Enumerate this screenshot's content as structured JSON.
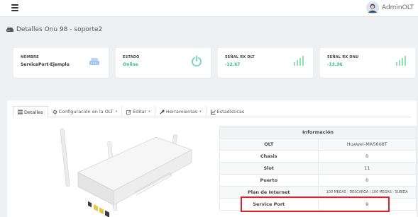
{
  "topbar": {
    "user_name": "AdminOLT"
  },
  "page": {
    "title": "Detalles Onu 98 - soporte2"
  },
  "cards": [
    {
      "label": "NOMBRE",
      "value": "ServicePort-Ejemplo",
      "value_color": "#333333",
      "icon": "router-icon",
      "icon_color": "#9ec5f0"
    },
    {
      "label": "ESTADO",
      "value": "Online",
      "value_color": "#2ebf8e",
      "icon": "power-icon",
      "icon_color": "#7fd8bc"
    },
    {
      "label": "SEÑAL RX OLT",
      "value": "-12.67",
      "value_color": "#2ebf8e",
      "icon": "signal-bars-icon",
      "icon_color": "#8fe0b8"
    },
    {
      "label": "SEÑAL RX ONU",
      "value": "-13.36",
      "value_color": "#2ebf8e",
      "icon": "signal-bars-icon",
      "icon_color": "#8fe0b8"
    }
  ],
  "tabs": [
    {
      "label": "Detalles",
      "active": true
    },
    {
      "label": "Configuración en la OLT",
      "dropdown": true
    },
    {
      "label": "Editar",
      "dropdown": true
    },
    {
      "label": "Herramientas",
      "dropdown": true
    },
    {
      "label": "Estadísticas",
      "dropdown": false
    }
  ],
  "info": {
    "header": "Información",
    "rows": [
      {
        "key": "OLT",
        "value": "Huawei-MA5608T"
      },
      {
        "key": "Chasis",
        "value": "0"
      },
      {
        "key": "Slot",
        "value": "11"
      },
      {
        "key": "Puerto",
        "value": "0"
      },
      {
        "key": "Plan de Internet",
        "value": "100 MEGAS - DESCARGA / 100 MEGAS - SUBIDA"
      },
      {
        "key": "Service Port",
        "value": "9"
      }
    ]
  },
  "colors": {
    "highlight": "#d9252a",
    "accent_green": "#2ebf8e"
  }
}
